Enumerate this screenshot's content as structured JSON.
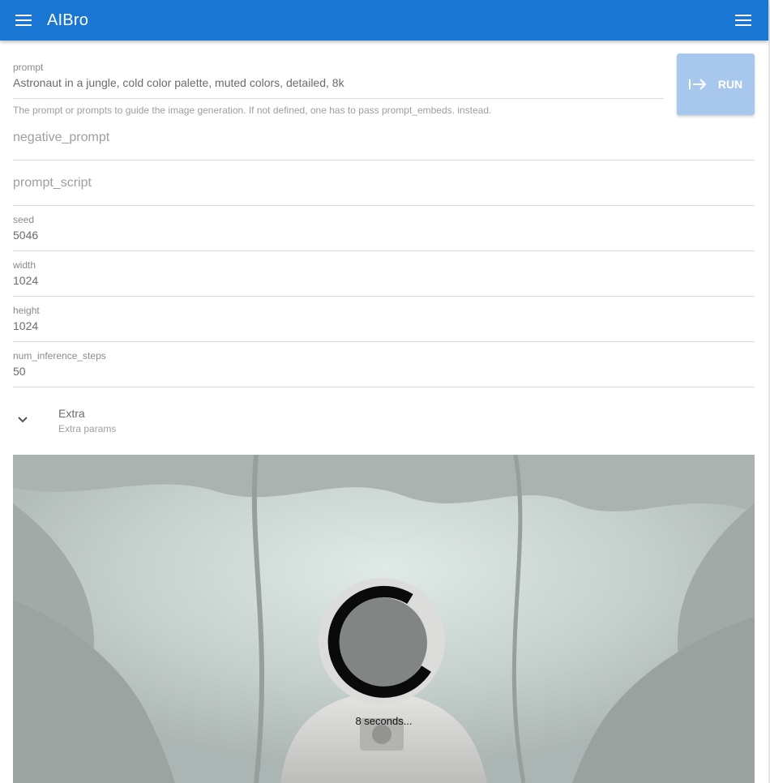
{
  "app": {
    "title": "AIBro",
    "accent_color": "#1976d2",
    "menu_icon": "menu-icon",
    "right_menu_icon": "menu-icon"
  },
  "form": {
    "prompt": {
      "label": "prompt",
      "value": "Astronaut in a jungle, cold color palette, muted colors, detailed, 8k",
      "hint": "The prompt or prompts to guide the image generation. If not defined, one has to pass prompt_embeds. instead."
    },
    "negative_prompt": {
      "placeholder": "negative_prompt"
    },
    "prompt_script": {
      "placeholder": "prompt_script"
    },
    "seed": {
      "label": "seed",
      "value": "5046"
    },
    "width": {
      "label": "width",
      "value": "1024"
    },
    "height": {
      "label": "height",
      "value": "1024"
    },
    "num_inference_steps": {
      "label": "num_inference_steps",
      "value": "50"
    }
  },
  "run_button": {
    "label": "RUN",
    "icon": "arrow-right-to-line-icon",
    "color": "#a7c8ec"
  },
  "extra": {
    "title": "Extra",
    "subtitle": "Extra params",
    "icon": "chevron-down-icon"
  },
  "result": {
    "progress_text": "8 seconds...",
    "spinner_icon": "loading-spinner-icon"
  }
}
